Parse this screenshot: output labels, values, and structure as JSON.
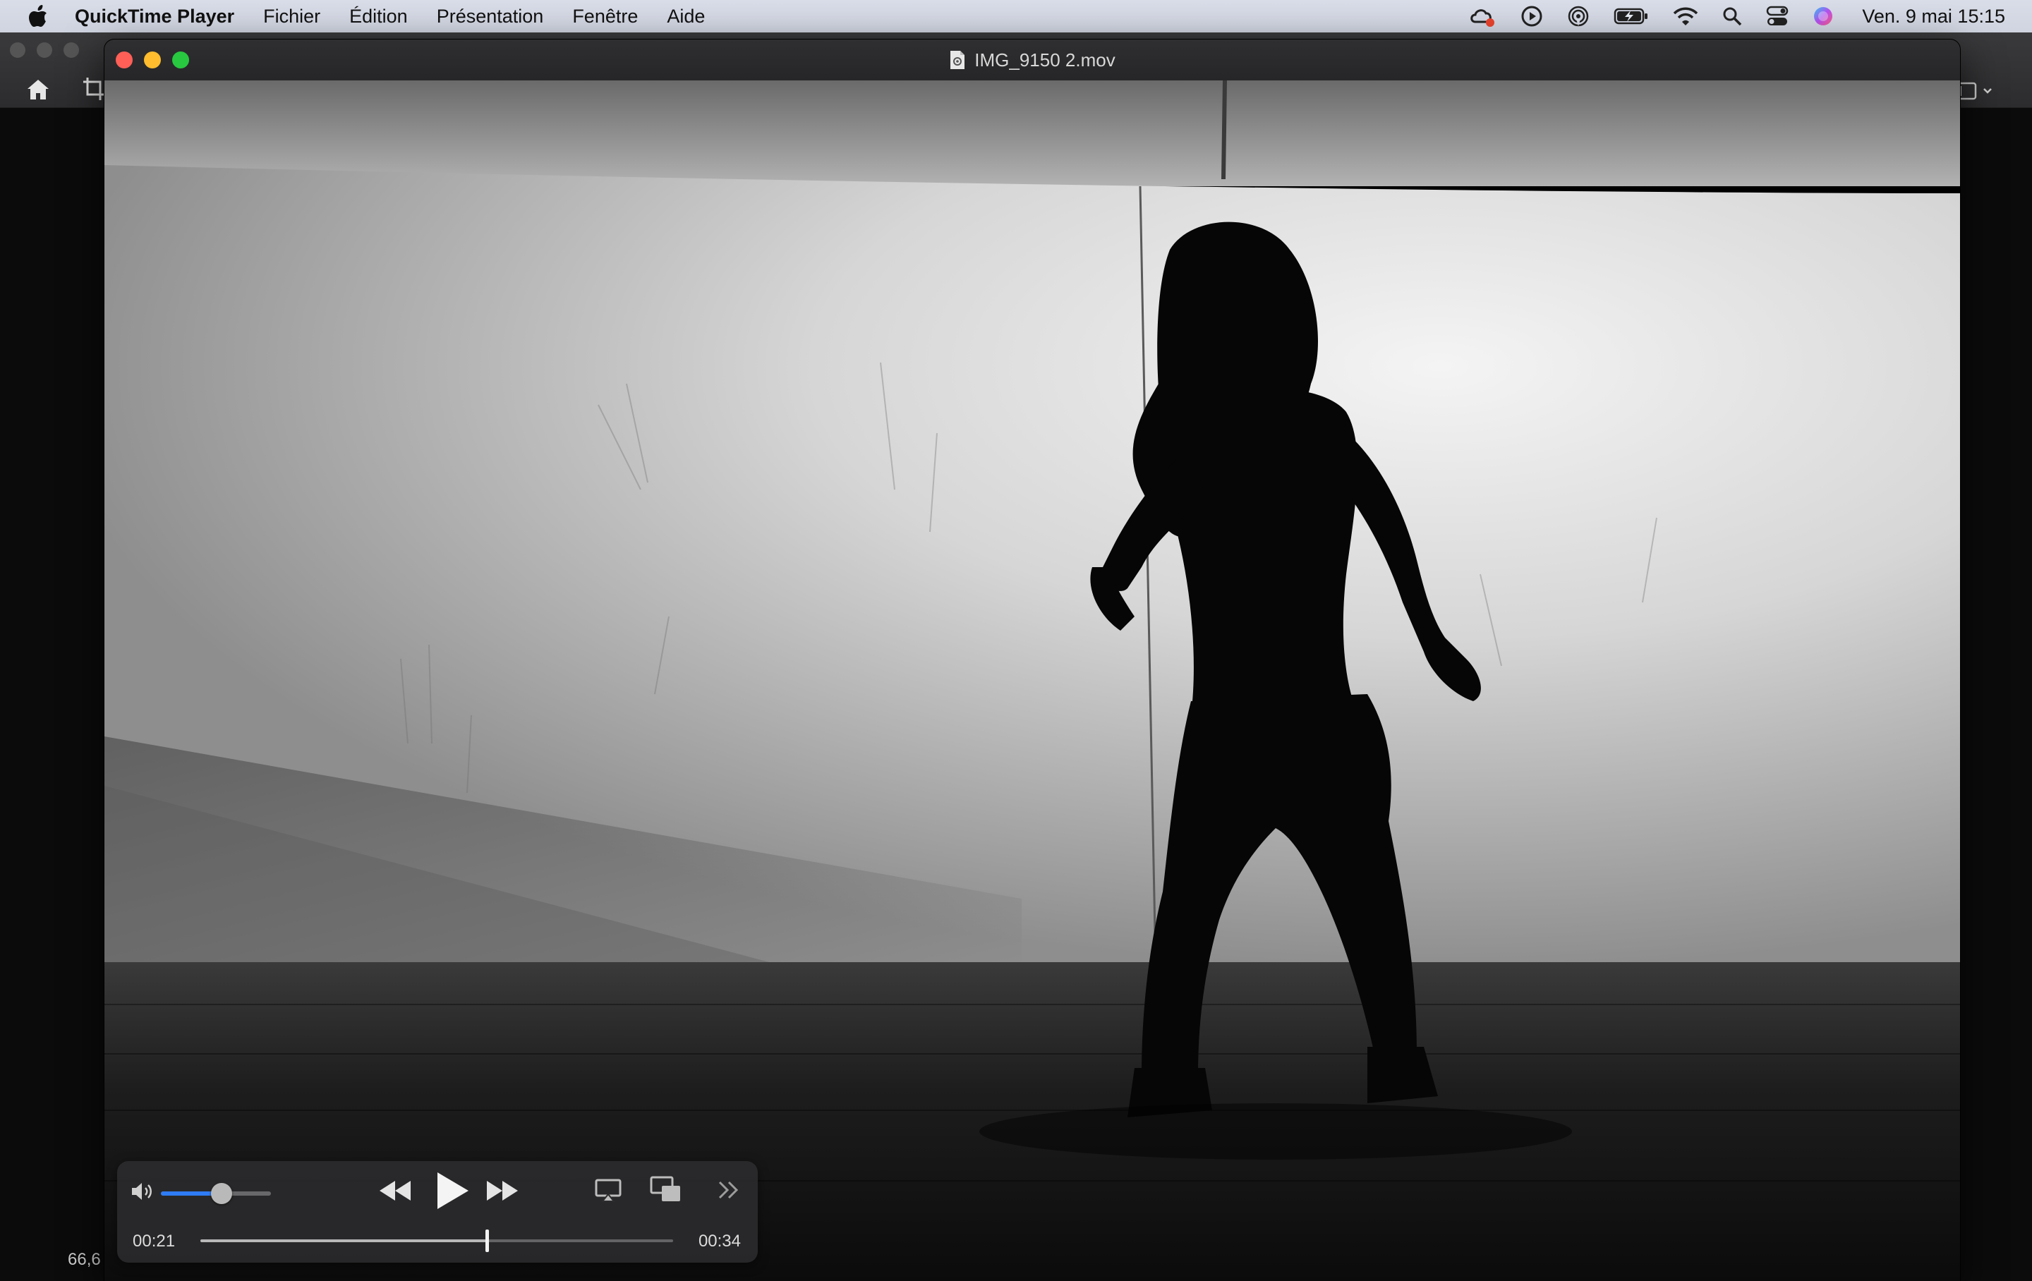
{
  "menubar": {
    "apple_icon": "apple-logo-icon",
    "app_name": "QuickTime Player",
    "items": [
      {
        "label": "Fichier"
      },
      {
        "label": "Édition"
      },
      {
        "label": "Présentation"
      },
      {
        "label": "Fenêtre"
      },
      {
        "label": "Aide"
      }
    ],
    "status_icons": [
      "creative-cloud-icon",
      "play-circle-icon",
      "airdrop-icon",
      "battery-charging-icon",
      "wifi-icon",
      "search-icon",
      "control-center-icon",
      "siri-icon"
    ],
    "clock": "Ven. 9 mai  15:15"
  },
  "background_app": {
    "zoom_label": "66,6"
  },
  "window": {
    "title": "IMG_9150 2.mov",
    "title_icon": "movie-document-icon"
  },
  "video": {
    "description_icon": "video-frame"
  },
  "controls": {
    "volume_level": 0.55,
    "current_time": "00:21",
    "total_time": "00:34",
    "progress": 0.606,
    "colors": {
      "accent": "#2f7cf6",
      "bar_bg": "#2c2c2e"
    }
  }
}
